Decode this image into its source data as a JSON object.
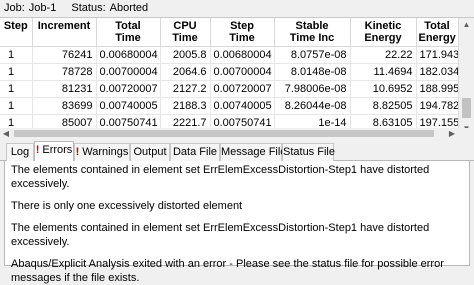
{
  "job_bar": {
    "job_label": "Job:",
    "job_value": "Job-1",
    "status_label": "Status:",
    "status_value": "Aborted"
  },
  "table": {
    "headers": [
      [
        "Step",
        ""
      ],
      [
        "Increment",
        ""
      ],
      [
        "Total",
        "Time"
      ],
      [
        "CPU",
        "Time"
      ],
      [
        "Step",
        "Time"
      ],
      [
        "Stable",
        "Time Inc"
      ],
      [
        "Kinetic",
        "Energy"
      ],
      [
        "Total",
        "Energy"
      ]
    ],
    "rows": [
      [
        "1",
        "76241",
        "0.00680004",
        "2005.8",
        "0.00680004",
        "8.0757e-08",
        "22.22",
        "171.943"
      ],
      [
        "1",
        "78728",
        "0.00700004",
        "2064.6",
        "0.00700004",
        "8.0148e-08",
        "11.4694",
        "182.034"
      ],
      [
        "1",
        "81231",
        "0.00720007",
        "2127.2",
        "0.00720007",
        "7.98006e-08",
        "10.6952",
        "188.995"
      ],
      [
        "1",
        "83699",
        "0.00740005",
        "2188.3",
        "0.00740005",
        "8.26044e-08",
        "8.82505",
        "194.782"
      ],
      [
        "1",
        "85007",
        "0.00750741",
        "2221.7",
        "0.00750741",
        "1e-14",
        "8.63105",
        "197.155"
      ]
    ]
  },
  "tabs": [
    {
      "label": "Log",
      "alert": false,
      "active": false
    },
    {
      "label": "Errors",
      "alert": true,
      "active": true
    },
    {
      "label": "Warnings",
      "alert": true,
      "active": false
    },
    {
      "label": "Output",
      "alert": false,
      "active": false
    },
    {
      "label": "Data File",
      "alert": false,
      "active": false
    },
    {
      "label": "Message File",
      "alert": false,
      "active": false
    },
    {
      "label": "Status File",
      "alert": false,
      "active": false
    }
  ],
  "alert_glyph": "!",
  "messages": [
    "The elements contained in element set ErrElemExcessDistortion-Step1 have distorted excessively.",
    "There is only one excessively distorted element",
    "The elements contained in element set ErrElemExcessDistortion-Step1 have distorted excessively.",
    "Abaqus/Explicit Analysis exited with an error - Please see the  status file for possible error messages if the file exists."
  ],
  "icons": {
    "scroll_up": "scroll-up-arrow",
    "scroll_down": "scroll-down-arrow",
    "scroll_left": "scroll-left-arrow",
    "scroll_right": "scroll-right-arrow",
    "alert": "exclamation-alert"
  },
  "colors": {
    "alert": "#d00000"
  }
}
